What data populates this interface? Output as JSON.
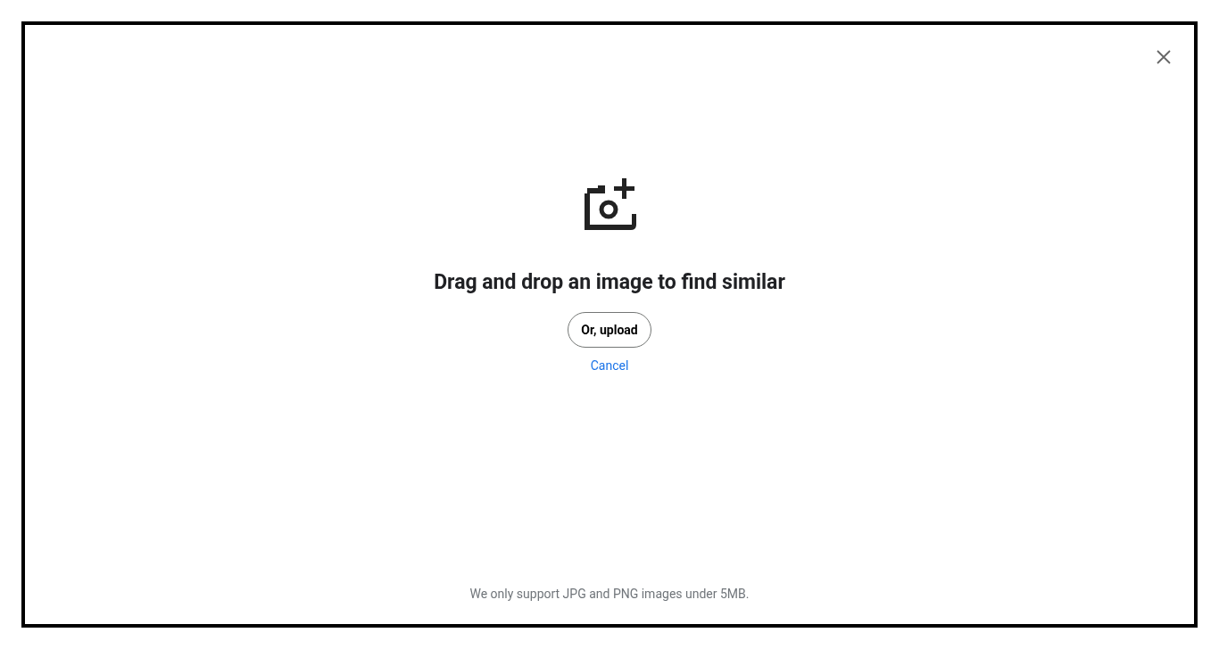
{
  "dialog": {
    "title": "Drag and drop an image to find similar",
    "upload_button": "Or, upload",
    "cancel_link": "Cancel",
    "footnote": "We only support JPG and PNG images under 5MB."
  }
}
